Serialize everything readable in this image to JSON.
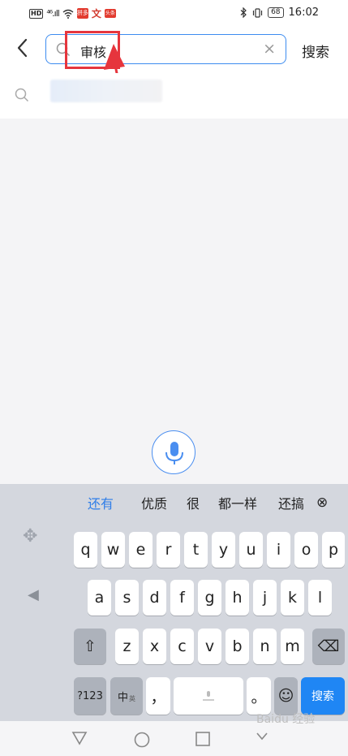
{
  "status_bar": {
    "left": {
      "hd": "HD",
      "signal": "⁴⁶.ıll",
      "wifi": "wifi",
      "app1": "拼多",
      "app2": "文",
      "app3": "头条"
    },
    "right": {
      "bluetooth": "bluetooth",
      "vibrate": "vibrate",
      "battery": "68",
      "time": "16:02"
    }
  },
  "header": {
    "back_icon": "‹",
    "search_value": "审核",
    "clear_icon": "×",
    "search_button": "搜索"
  },
  "suggestion": {
    "icon": "search-icon"
  },
  "keyboard": {
    "candidates": [
      "还有",
      "优质",
      "很",
      "都一样",
      "还搞"
    ],
    "delete_candidates": "⊗",
    "row1": [
      "q",
      "w",
      "e",
      "r",
      "t",
      "y",
      "u",
      "i",
      "o",
      "p"
    ],
    "row2": [
      "a",
      "s",
      "d",
      "f",
      "g",
      "h",
      "j",
      "k",
      "l"
    ],
    "row3": [
      "z",
      "x",
      "c",
      "v",
      "b",
      "n",
      "m"
    ],
    "shift": "⇧",
    "backspace": "⌫",
    "num_key": "?123",
    "lang_key": "中",
    "lang_sub": "英",
    "comma": "，",
    "period": "。",
    "emoji": "☺",
    "search_key": "搜索"
  },
  "nav": {
    "back": "▽",
    "home": "○",
    "recent": "□",
    "down": "⌄"
  },
  "watermark": "Baidu 经验",
  "colors": {
    "accent": "#1f86f4",
    "highlight": "#e6353d"
  }
}
